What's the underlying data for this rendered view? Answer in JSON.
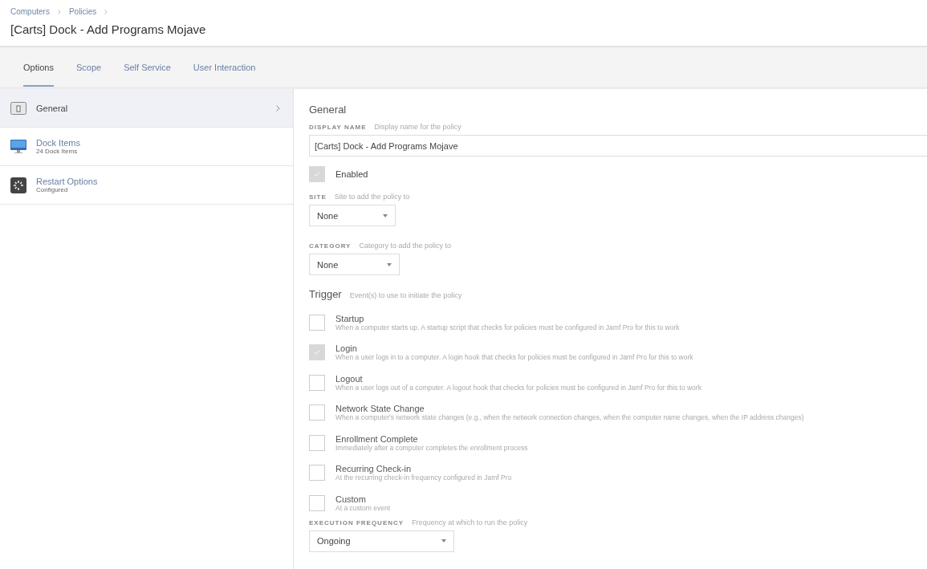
{
  "breadcrumbs": [
    "Computers",
    "Policies"
  ],
  "page_title": "[Carts] Dock - Add Programs Mojave",
  "tabs": [
    {
      "label": "Options",
      "selected": true
    },
    {
      "label": "Scope",
      "selected": false
    },
    {
      "label": "Self Service",
      "selected": false
    },
    {
      "label": "User Interaction",
      "selected": false
    }
  ],
  "sidebar": {
    "items": [
      {
        "kind": "general",
        "label": "General",
        "selected": true
      },
      {
        "kind": "dock",
        "label": "Dock Items",
        "subtitle": "24 Dock Items",
        "selected": false
      },
      {
        "kind": "restart",
        "label": "Restart Options",
        "subtitle": "Configured",
        "selected": false
      }
    ]
  },
  "general": {
    "heading": "General",
    "display_name": {
      "label": "DISPLAY NAME",
      "hint": "Display name for the policy",
      "value": "[Carts] Dock - Add Programs Mojave"
    },
    "enabled": {
      "label": "Enabled",
      "checked": true
    },
    "site": {
      "label": "SITE",
      "hint": "Site to add the policy to",
      "value": "None"
    },
    "category": {
      "label": "CATEGORY",
      "hint": "Category to add the policy to",
      "value": "None"
    },
    "trigger": {
      "heading": "Trigger",
      "hint": "Event(s) to use to initiate the policy",
      "options": [
        {
          "label": "Startup",
          "description": "When a computer starts up. A startup script that checks for policies must be configured in Jamf Pro for this to work",
          "checked": false
        },
        {
          "label": "Login",
          "description": "When a user logs in to a computer. A login hook that checks for policies must be configured in Jamf Pro for this to work",
          "checked": true
        },
        {
          "label": "Logout",
          "description": "When a user logs out of a computer. A logout hook that checks for policies must be configured in Jamf Pro for this to work",
          "checked": false
        },
        {
          "label": "Network State Change",
          "description": "When a computer's network state changes (e.g., when the network connection changes, when the computer name changes, when the IP address changes)",
          "checked": false
        },
        {
          "label": "Enrollment Complete",
          "description": "Immediately after a computer completes the enrollment process",
          "checked": false
        },
        {
          "label": "Recurring Check-in",
          "description": "At the recurring check-in frequency configured in Jamf Pro",
          "checked": false
        },
        {
          "label": "Custom",
          "description": "At a custom event",
          "checked": false
        }
      ]
    },
    "execution_frequency": {
      "label": "EXECUTION FREQUENCY",
      "hint": "Frequency at which to run the policy",
      "value": "Ongoing"
    }
  }
}
